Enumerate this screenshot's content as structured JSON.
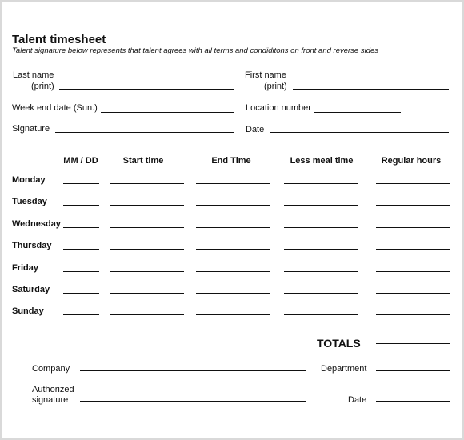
{
  "form": {
    "title": "Talent timesheet",
    "subtitle": "Talent signature below represents that talent agrees with all terms and condiditons on front and reverse sides"
  },
  "header_fields": {
    "last_name": {
      "line1": "Last name",
      "line2": "(print)"
    },
    "first_name": {
      "line1": "First name",
      "line2": "(print)"
    },
    "week_end_date": "Week end date (Sun.)",
    "location_number": "Location number",
    "signature": "Signature",
    "date": "Date"
  },
  "table": {
    "columns": [
      "MM / DD",
      "Start time",
      "End Time",
      "Less meal time",
      "Regular hours"
    ],
    "rows": [
      "Monday",
      "Tuesday",
      "Wednesday",
      "Thursday",
      "Friday",
      "Saturday",
      "Sunday"
    ]
  },
  "totals_label": "TOTALS",
  "footer": {
    "company": "Company",
    "department": "Department",
    "authorized_signature": {
      "line1": "Authorized",
      "line2": "signature"
    },
    "date": "Date"
  }
}
